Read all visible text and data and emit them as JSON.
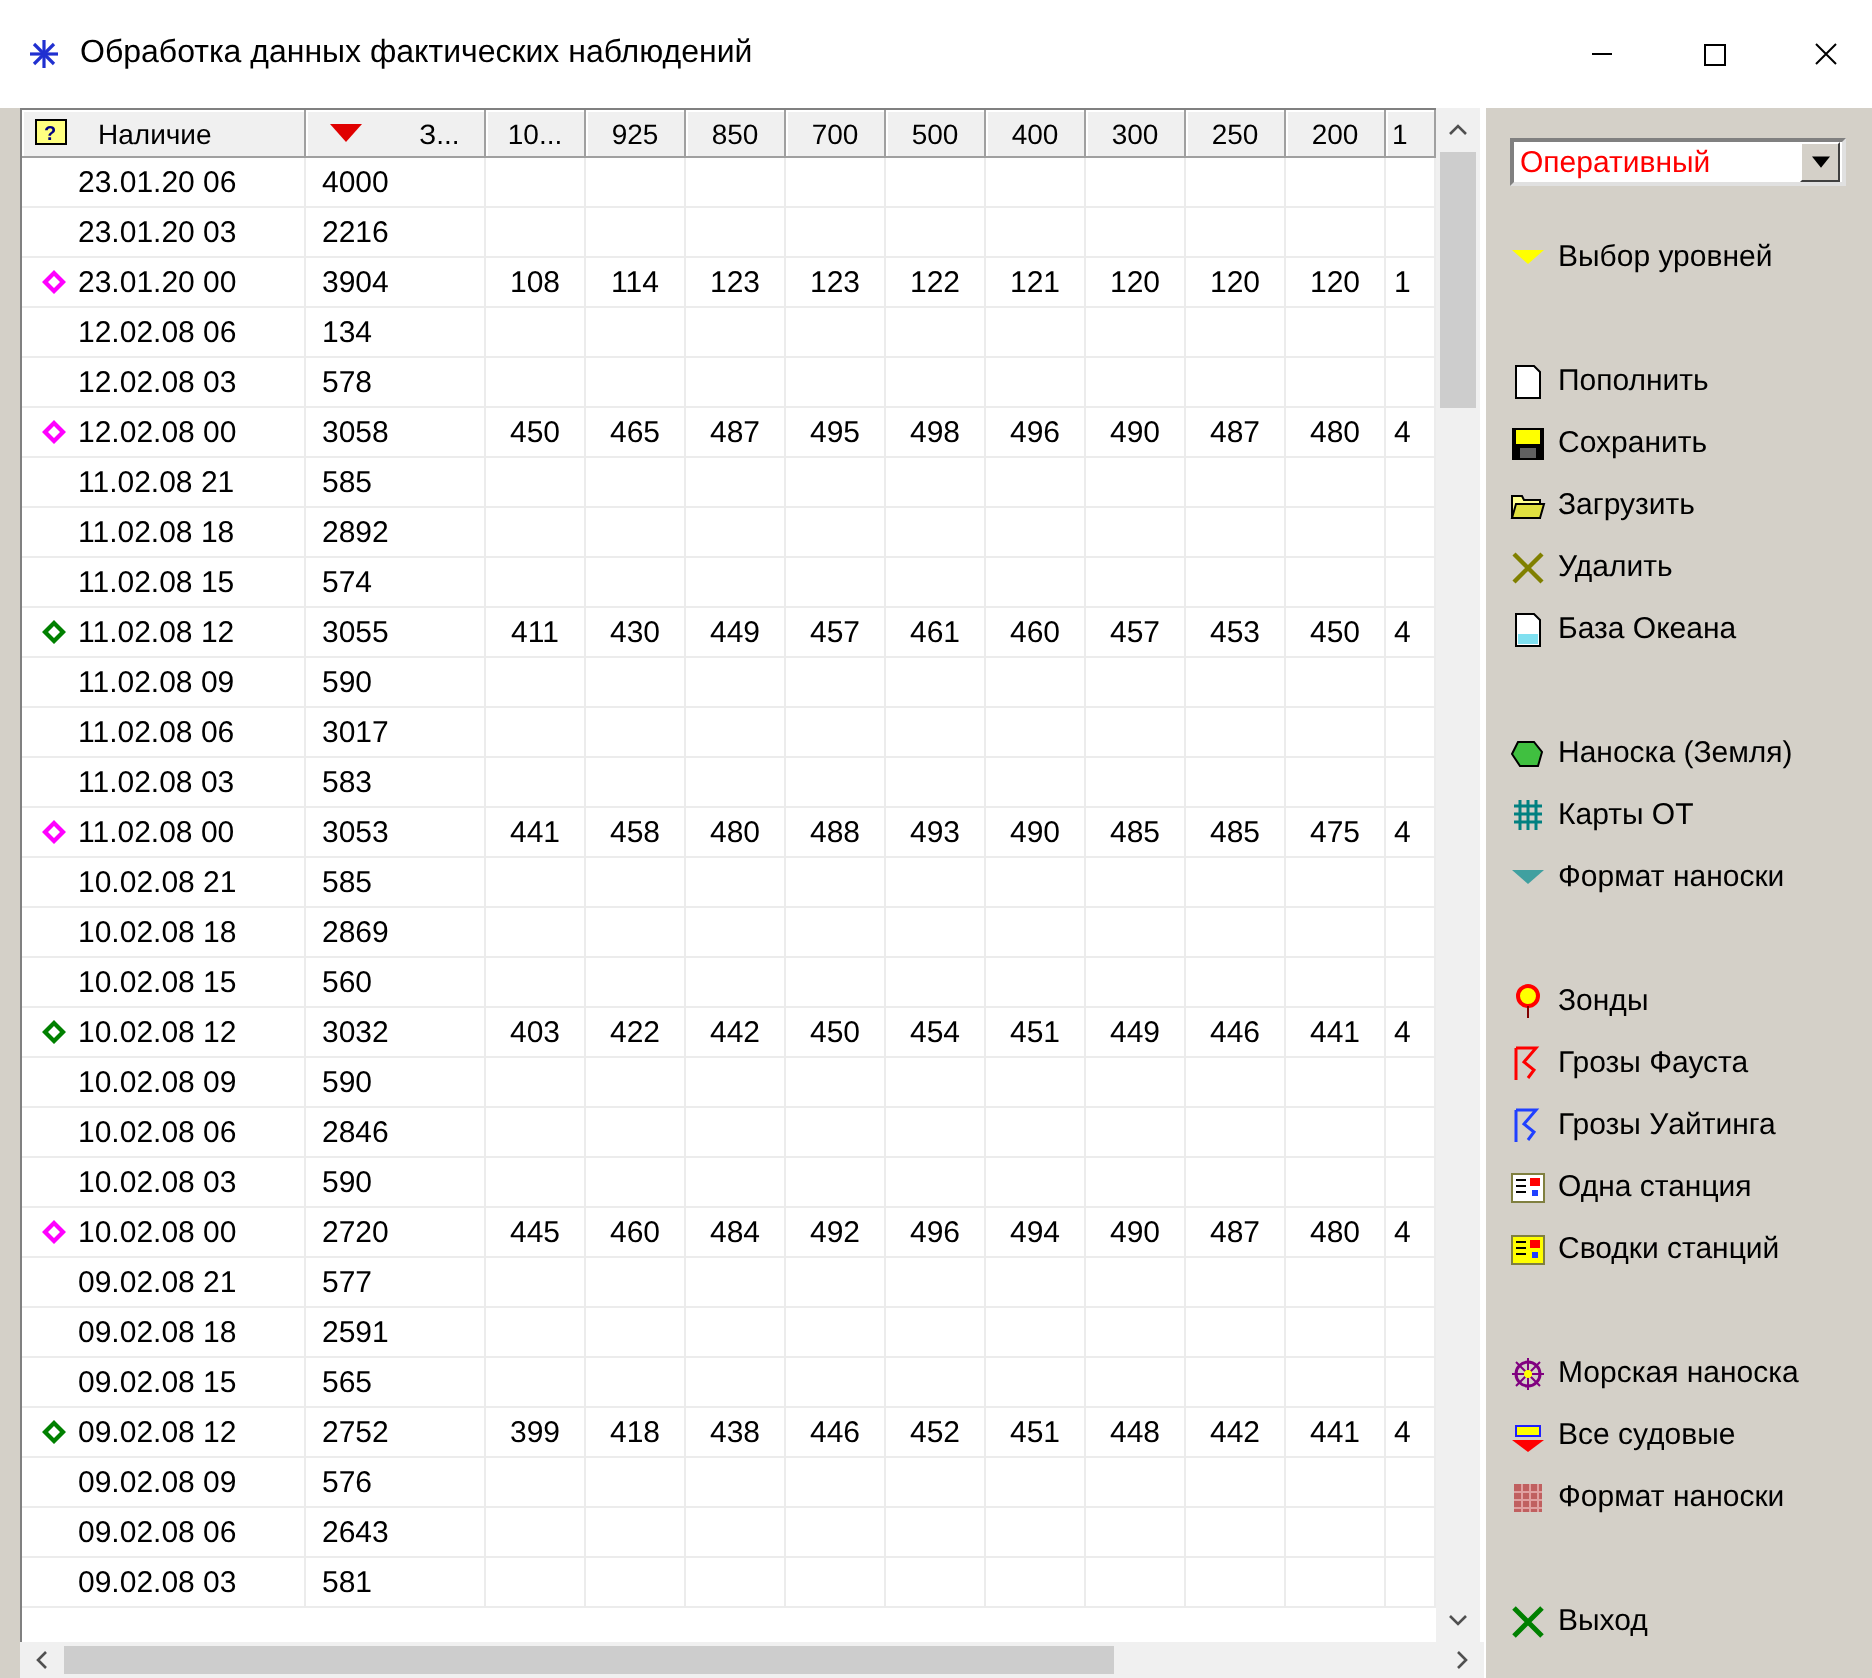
{
  "window": {
    "title": "Обработка данных фактических наблюдений"
  },
  "table": {
    "help_mark": "?",
    "columns": [
      {
        "label": "Наличие",
        "sorted": false
      },
      {
        "label": "З...",
        "sorted": true
      },
      {
        "label": "10...",
        "sorted": false
      },
      {
        "label": "925",
        "sorted": false
      },
      {
        "label": "850",
        "sorted": false
      },
      {
        "label": "700",
        "sorted": false
      },
      {
        "label": "500",
        "sorted": false
      },
      {
        "label": "400",
        "sorted": false
      },
      {
        "label": "300",
        "sorted": false
      },
      {
        "label": "250",
        "sorted": false
      },
      {
        "label": "200",
        "sorted": false
      },
      {
        "label": "1",
        "sorted": false
      }
    ],
    "rows": [
      {
        "time": "23.01.20 06",
        "value": "4000"
      },
      {
        "time": "23.01.20 03",
        "value": "2216"
      },
      {
        "time": "23.01.20 00",
        "value": "3904",
        "color": "#ff00ff",
        "levels": [
          "108",
          "114",
          "123",
          "123",
          "122",
          "121",
          "120",
          "120",
          "120",
          "1"
        ]
      },
      {
        "time": "12.02.08 06",
        "value": "134"
      },
      {
        "time": "12.02.08 03",
        "value": "578"
      },
      {
        "time": "12.02.08 00",
        "value": "3058",
        "color": "#ff00ff",
        "levels": [
          "450",
          "465",
          "487",
          "495",
          "498",
          "496",
          "490",
          "487",
          "480",
          "4"
        ]
      },
      {
        "time": "11.02.08 21",
        "value": "585"
      },
      {
        "time": "11.02.08 18",
        "value": "2892"
      },
      {
        "time": "11.02.08 15",
        "value": "574"
      },
      {
        "time": "11.02.08 12",
        "value": "3055",
        "color": "#008000",
        "levels": [
          "411",
          "430",
          "449",
          "457",
          "461",
          "460",
          "457",
          "453",
          "450",
          "4"
        ]
      },
      {
        "time": "11.02.08 09",
        "value": "590"
      },
      {
        "time": "11.02.08 06",
        "value": "3017"
      },
      {
        "time": "11.02.08 03",
        "value": "583"
      },
      {
        "time": "11.02.08 00",
        "value": "3053",
        "color": "#ff00ff",
        "levels": [
          "441",
          "458",
          "480",
          "488",
          "493",
          "490",
          "485",
          "485",
          "475",
          "4"
        ]
      },
      {
        "time": "10.02.08 21",
        "value": "585"
      },
      {
        "time": "10.02.08 18",
        "value": "2869"
      },
      {
        "time": "10.02.08 15",
        "value": "560"
      },
      {
        "time": "10.02.08 12",
        "value": "3032",
        "color": "#008000",
        "levels": [
          "403",
          "422",
          "442",
          "450",
          "454",
          "451",
          "449",
          "446",
          "441",
          "4"
        ]
      },
      {
        "time": "10.02.08 09",
        "value": "590"
      },
      {
        "time": "10.02.08 06",
        "value": "2846"
      },
      {
        "time": "10.02.08 03",
        "value": "590"
      },
      {
        "time": "10.02.08 00",
        "value": "2720",
        "color": "#ff00ff",
        "levels": [
          "445",
          "460",
          "484",
          "492",
          "496",
          "494",
          "490",
          "487",
          "480",
          "4"
        ]
      },
      {
        "time": "09.02.08 21",
        "value": "577"
      },
      {
        "time": "09.02.08 18",
        "value": "2591"
      },
      {
        "time": "09.02.08 15",
        "value": "565"
      },
      {
        "time": "09.02.08 12",
        "value": "2752",
        "color": "#008000",
        "levels": [
          "399",
          "418",
          "438",
          "446",
          "452",
          "451",
          "448",
          "442",
          "441",
          "4"
        ]
      },
      {
        "time": "09.02.08 09",
        "value": "576"
      },
      {
        "time": "09.02.08 06",
        "value": "2643"
      },
      {
        "time": "09.02.08 03",
        "value": "581"
      }
    ]
  },
  "sidebar": {
    "mode_select": {
      "value": "Оперативный"
    },
    "groups": [
      {
        "items": [
          {
            "label": "Выбор уровней"
          }
        ]
      },
      {
        "items": [
          {
            "label": "Пополнить"
          },
          {
            "label": "Сохранить"
          },
          {
            "label": "Загрузить"
          },
          {
            "label": "Удалить"
          },
          {
            "label": "База Океана"
          }
        ]
      },
      {
        "items": [
          {
            "label": "Наноска (Земля)"
          },
          {
            "label": "Карты ОТ"
          },
          {
            "label": "Формат наноски"
          }
        ]
      },
      {
        "items": [
          {
            "label": "Зонды"
          },
          {
            "label": "Грозы Фауста"
          },
          {
            "label": "Грозы Уайтинга"
          },
          {
            "label": "Одна станция"
          },
          {
            "label": "Сводки станций"
          }
        ]
      },
      {
        "items": [
          {
            "label": "Морская наноска"
          },
          {
            "label": "Все судовые"
          },
          {
            "label": "Формат наноски"
          }
        ]
      },
      {
        "items": [
          {
            "label": "Выход"
          }
        ]
      }
    ]
  }
}
